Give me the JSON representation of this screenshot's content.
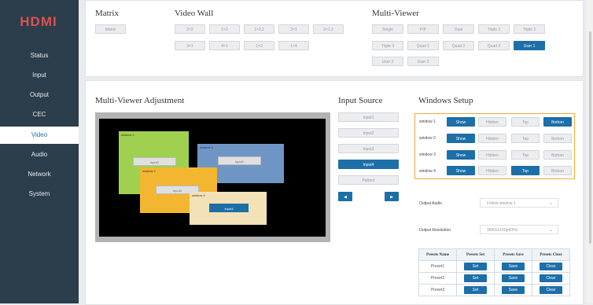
{
  "brand": {
    "logo_text": "HDMI"
  },
  "sidebar": {
    "items": [
      {
        "label": "Status"
      },
      {
        "label": "Input"
      },
      {
        "label": "Output"
      },
      {
        "label": "CEC"
      },
      {
        "label": "Video"
      },
      {
        "label": "Audio"
      },
      {
        "label": "Network"
      },
      {
        "label": "System"
      }
    ],
    "active": "Video"
  },
  "matrix": {
    "title": "Matrix",
    "button": "Matrix"
  },
  "video_wall": {
    "title": "Video Wall",
    "row1": [
      "2×2",
      "1×2",
      "1×2.2",
      "2×1",
      "2×1.2"
    ],
    "row2": [
      "3×1",
      "4×1",
      "1×3",
      "1×4"
    ]
  },
  "multi_viewer": {
    "title": "Multi-Viewer",
    "row1": [
      "Single",
      "PIP",
      "Dual",
      "Triple 1",
      "Triple 2"
    ],
    "row2": [
      "Triple 3",
      "Quad 1",
      "Quad 2",
      "Quad 3",
      "User 1"
    ],
    "row3": [
      "User 2",
      "User 3"
    ],
    "selected": "User 1"
  },
  "adjust": {
    "title": "Multi-Viewer Adjustment",
    "windows": [
      {
        "label": "window 1",
        "input": "Input1",
        "color": "#9fd050"
      },
      {
        "label": "window 2",
        "input": "Input3",
        "color": "#f2b630"
      },
      {
        "label": "window 3",
        "input": "Input1",
        "color": "#6f95c5"
      },
      {
        "label": "window 4",
        "input": "Input4",
        "color": "#f3e2b8"
      }
    ]
  },
  "input_source": {
    "title": "Input Source",
    "items": [
      "Input1",
      "Input2",
      "Input3",
      "Input4",
      "Pattern"
    ],
    "selected": "Input4",
    "prev": "◀",
    "next": "▶"
  },
  "windows_setup": {
    "title": "Windows Setup",
    "rows": [
      {
        "label": "window 1",
        "buttons": [
          "Show",
          "Hidden",
          "Top",
          "Bottom"
        ],
        "active": [
          "Show",
          "Bottom"
        ]
      },
      {
        "label": "window 2",
        "buttons": [
          "Show",
          "Hidden",
          "Top",
          "Bottom"
        ],
        "active": [
          "Show"
        ]
      },
      {
        "label": "window 3",
        "buttons": [
          "Show",
          "Hidden",
          "Top",
          "Bottom"
        ],
        "active": [
          "Show"
        ]
      },
      {
        "label": "window 4",
        "buttons": [
          "Show",
          "Hidden",
          "Top",
          "Bottom"
        ],
        "active": [
          "Show",
          "Top"
        ]
      }
    ],
    "highlight_color": "#f3a93a"
  },
  "output_audio": {
    "label": "Output Audio",
    "value": "Follow window 1"
  },
  "output_resolution": {
    "label": "Output Resolution",
    "value": "3840x2160p60Hz"
  },
  "presets": {
    "headers": [
      "Presets Name",
      "Presets Set",
      "Presets Save",
      "Presets Clear"
    ],
    "rows": [
      {
        "name": "Preset1",
        "set": "Set",
        "save": "Save",
        "clear": "Clear"
      },
      {
        "name": "Preset2",
        "set": "Set",
        "save": "Save",
        "clear": "Clear"
      },
      {
        "name": "Preset3",
        "set": "Set",
        "save": "Save",
        "clear": "Clear"
      }
    ]
  },
  "colors": {
    "sidebar": "#2c3d4b",
    "accent": "#1d6fa8"
  }
}
